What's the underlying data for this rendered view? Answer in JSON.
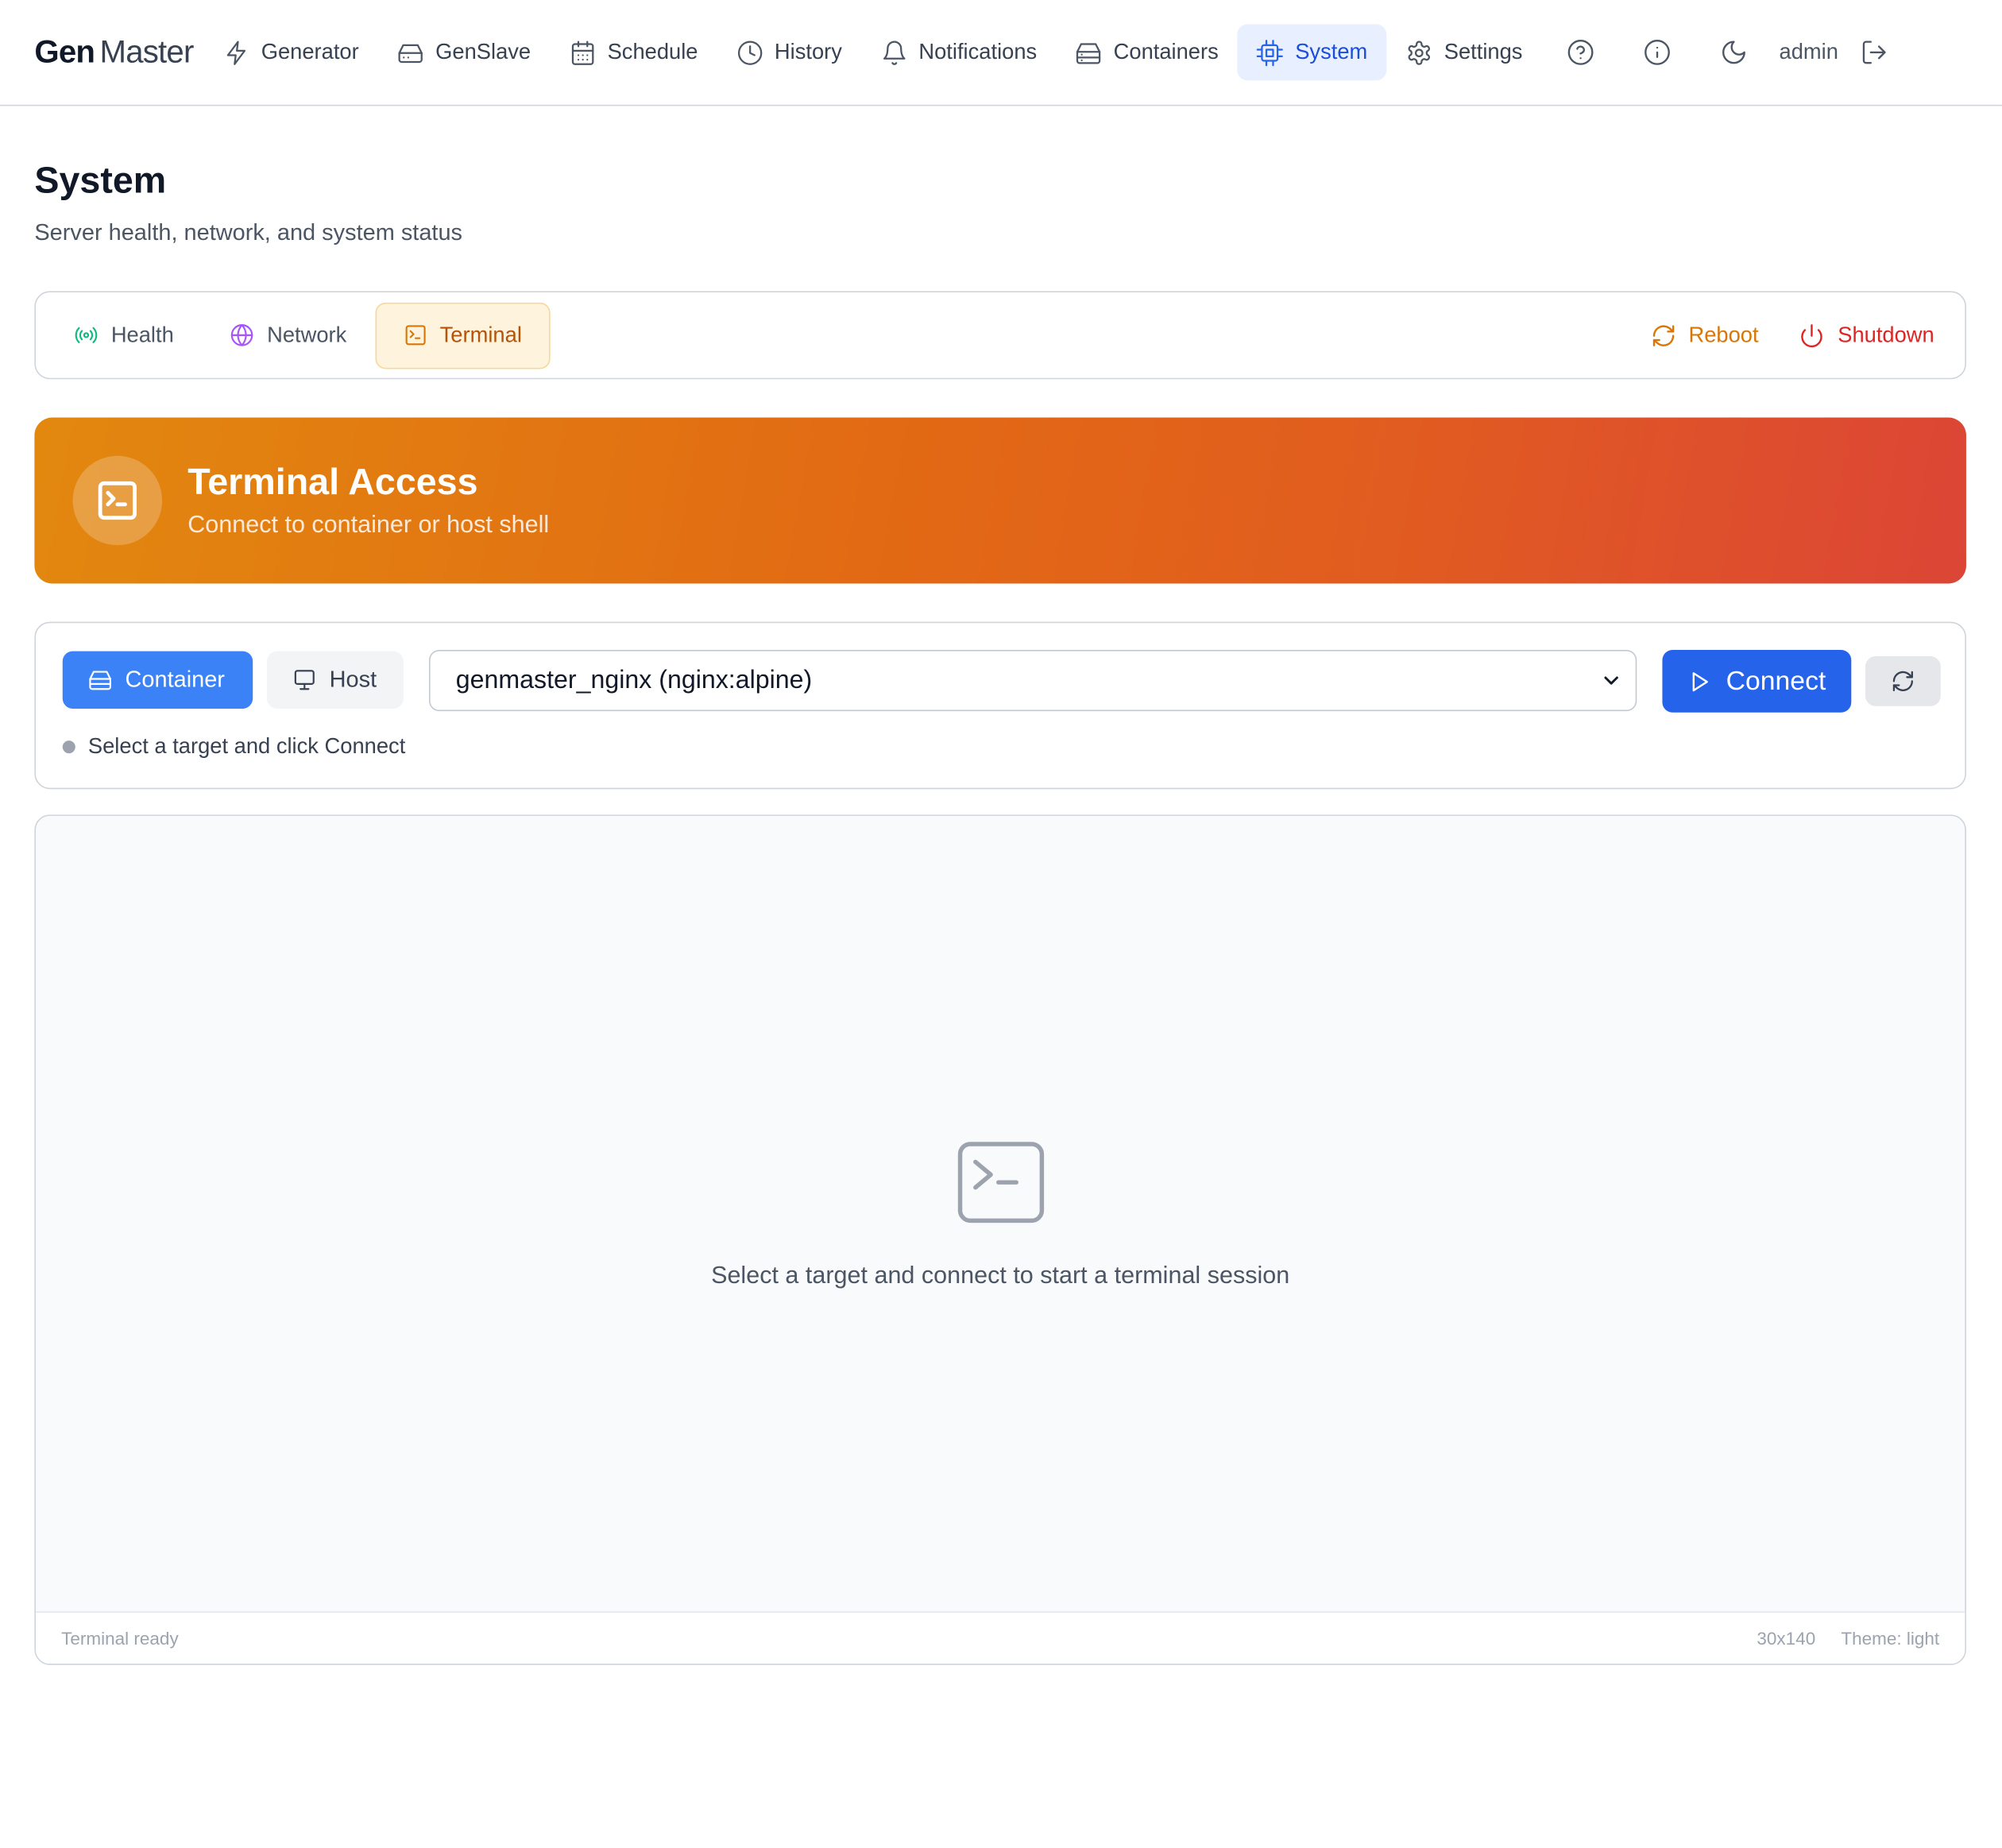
{
  "nav": {
    "brand_bold": "Gen",
    "brand_light": "Master",
    "items": [
      {
        "label": "Generator",
        "icon": "zap-icon"
      },
      {
        "label": "GenSlave",
        "icon": "hard-drive-icon"
      },
      {
        "label": "Schedule",
        "icon": "calendar-icon"
      },
      {
        "label": "History",
        "icon": "clock-icon"
      },
      {
        "label": "Notifications",
        "icon": "bell-icon"
      },
      {
        "label": "Containers",
        "icon": "server-icon"
      },
      {
        "label": "System",
        "icon": "cpu-icon",
        "active": true
      },
      {
        "label": "Settings",
        "icon": "gear-icon"
      }
    ],
    "user": "admin"
  },
  "page": {
    "title": "System",
    "subtitle": "Server health, network, and system status"
  },
  "tabs": {
    "items": [
      {
        "label": "Health",
        "icon": "radio-signal-icon"
      },
      {
        "label": "Network",
        "icon": "globe-icon"
      },
      {
        "label": "Terminal",
        "icon": "terminal-icon",
        "active": true
      }
    ],
    "reboot_label": "Reboot",
    "shutdown_label": "Shutdown"
  },
  "banner": {
    "title": "Terminal Access",
    "subtitle": "Connect to container or host shell"
  },
  "controls": {
    "mode_container": "Container",
    "mode_host": "Host",
    "active_mode": "Container",
    "selected_target": "genmaster_nginx (nginx:alpine)",
    "connect_label": "Connect",
    "status_text": "Select a target and click Connect"
  },
  "terminal": {
    "empty_message": "Select a target and connect to start a terminal session",
    "footer_status": "Terminal ready",
    "dimensions": "30x140",
    "theme_label": "Theme: light"
  },
  "colors": {
    "accent_blue": "#2563eb",
    "terminal_tab_amber": "#b45309",
    "reboot": "#d97706",
    "shutdown": "#dc2626",
    "banner_start": "#e2880f",
    "banner_end": "#dc4536"
  }
}
